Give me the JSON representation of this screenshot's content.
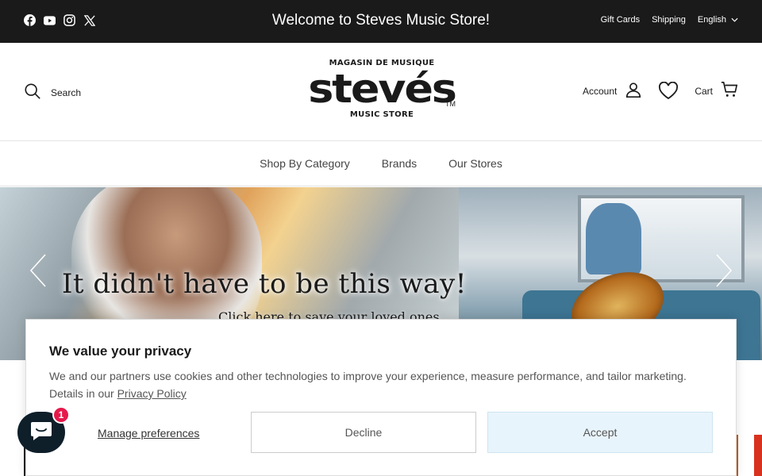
{
  "topbar": {
    "social_icons": [
      "facebook-icon",
      "youtube-icon",
      "instagram-icon",
      "x-icon"
    ],
    "announcement": "Welcome to Steves Music Store!",
    "links": {
      "gift_cards": "Gift Cards",
      "shipping": "Shipping",
      "language": "English"
    }
  },
  "header": {
    "search_label": "Search",
    "logo": {
      "top": "MAGASIN DE MUSIQUE",
      "name": "stevés",
      "bottom": "MUSIC STORE",
      "tm": "TM"
    },
    "account_label": "Account",
    "cart_label": "Cart"
  },
  "nav": {
    "items": [
      "Shop By Category",
      "Brands",
      "Our Stores"
    ]
  },
  "hero": {
    "headline": "It didn't have to be this way!",
    "subtext": "Click here to save your loved ones."
  },
  "cookie_banner": {
    "title": "We value your privacy",
    "body": "We and our partners use cookies and other technologies to improve your experience, measure performance, and tailor marketing. Details in our",
    "policy_link": "Privacy Policy",
    "manage": "Manage preferences",
    "decline": "Decline",
    "accept": "Accept"
  },
  "chat": {
    "badge_count": "1"
  },
  "colors": {
    "topbar_bg": "#1a1a1a",
    "accept_bg": "#e8f4fb",
    "badge": "#e5194b",
    "chat_bg": "#0e1f2a"
  }
}
